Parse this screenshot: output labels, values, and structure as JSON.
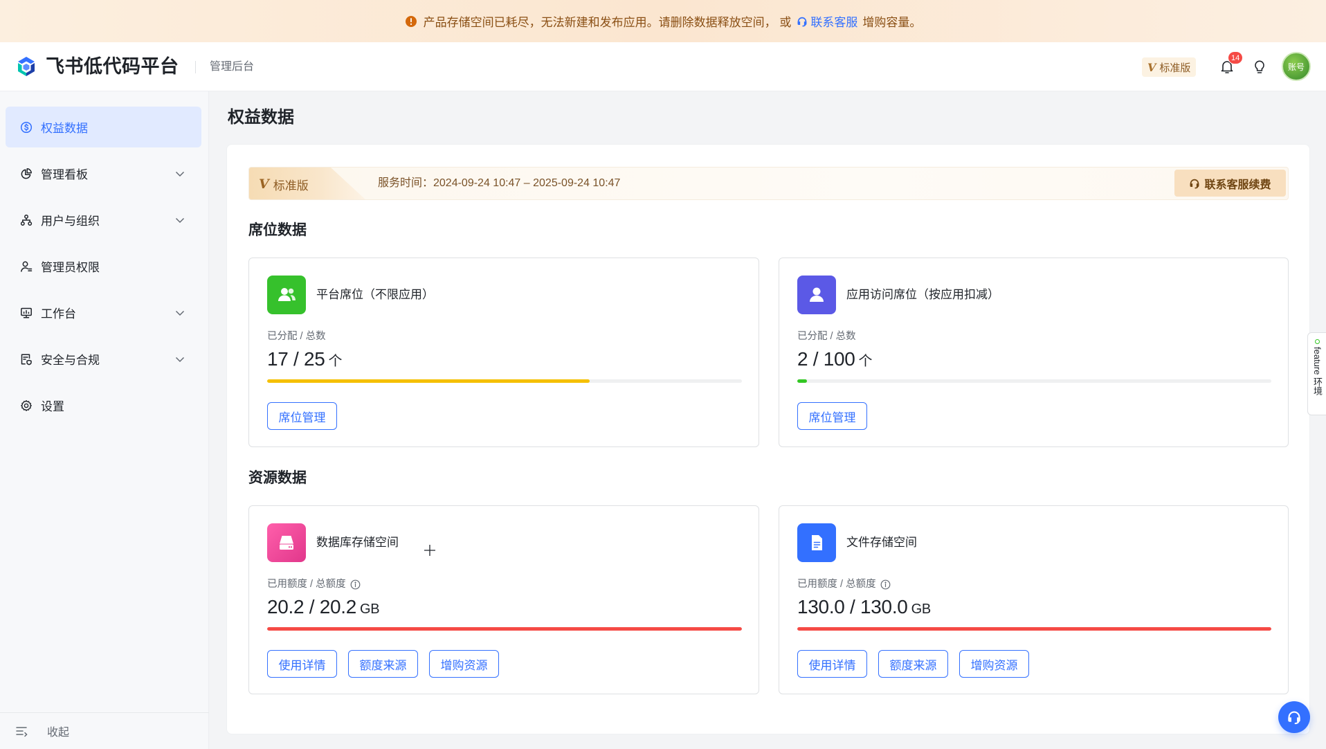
{
  "banner": {
    "icon": "warning-circle-icon",
    "message": "产品存储空间已耗尽，无法新建和发布应用。请删除数据释放空间， 或",
    "link_icon": "headset-icon",
    "link_label": "联系客服",
    "suffix": "增购容量。"
  },
  "header": {
    "app_title": "飞书低代码平台",
    "section_label": "管理后台",
    "plan_badge": {
      "mark": "V",
      "label": "标准版"
    },
    "notification_count": "14",
    "avatar_label": "账号"
  },
  "sidebar": {
    "items": [
      {
        "label": "权益数据",
        "icon": "dollar-circle-icon",
        "active": true,
        "expandable": false
      },
      {
        "label": "管理看板",
        "icon": "pie-chart-icon",
        "active": false,
        "expandable": true
      },
      {
        "label": "用户与组织",
        "icon": "org-structure-icon",
        "active": false,
        "expandable": true
      },
      {
        "label": "管理员权限",
        "icon": "admin-user-icon",
        "active": false,
        "expandable": false
      },
      {
        "label": "工作台",
        "icon": "monitor-icon",
        "active": false,
        "expandable": true
      },
      {
        "label": "安全与合规",
        "icon": "security-doc-icon",
        "active": false,
        "expandable": true
      },
      {
        "label": "设置",
        "icon": "gear-icon",
        "active": false,
        "expandable": false
      }
    ],
    "collapse_label": "收起"
  },
  "main": {
    "page_title": "权益数据",
    "plan": {
      "mark": "V",
      "label": "标准版",
      "service_time": "服务时间：2024-09-24 10:47 – 2025-09-24 10:47",
      "renew_button": "联系客服续费"
    },
    "seats": {
      "title": "席位数据",
      "cards": [
        {
          "title": "平台席位（不限应用）",
          "icon": "users-icon",
          "icon_color": "#36c12c",
          "metric_label": "已分配 / 总数",
          "value": "17 / 25",
          "unit": "个",
          "progress": 0.68,
          "bar_color": "#f5c000",
          "buttons": [
            "席位管理"
          ]
        },
        {
          "title": "应用访问席位（按应用扣减）",
          "icon": "user-icon",
          "icon_color": "#5b59e6",
          "metric_label": "已分配 / 总数",
          "value": "2 / 100",
          "unit": "个",
          "progress": 0.02,
          "bar_color": "#34c724",
          "buttons": [
            "席位管理"
          ]
        }
      ]
    },
    "resources": {
      "title": "资源数据",
      "cards": [
        {
          "title": "数据库存储空间",
          "icon": "database-icon",
          "icon_color": "linear-gradient(135deg, #ff5fab 0%, #e1378b 100%)",
          "metric_label": "已用额度 / 总额度",
          "value": "20.2 / 20.2",
          "unit": "GB",
          "progress": 1.0,
          "bar_color": "#f54a45",
          "buttons": [
            "使用详情",
            "额度来源",
            "增购资源"
          ]
        },
        {
          "title": "文件存储空间",
          "icon": "file-icon",
          "icon_color": "#3370ff",
          "metric_label": "已用额度 / 总额度",
          "value": "130.0 / 130.0",
          "unit": "GB",
          "progress": 1.0,
          "bar_color": "#f54a45",
          "buttons": [
            "使用详情",
            "额度来源",
            "增购资源"
          ]
        }
      ]
    }
  },
  "feature_tab": "feature 环境",
  "colors": {
    "accent": "#3370ff",
    "active_bg": "#e1eaff",
    "warning": "#d4680b",
    "danger": "#f54a45"
  }
}
